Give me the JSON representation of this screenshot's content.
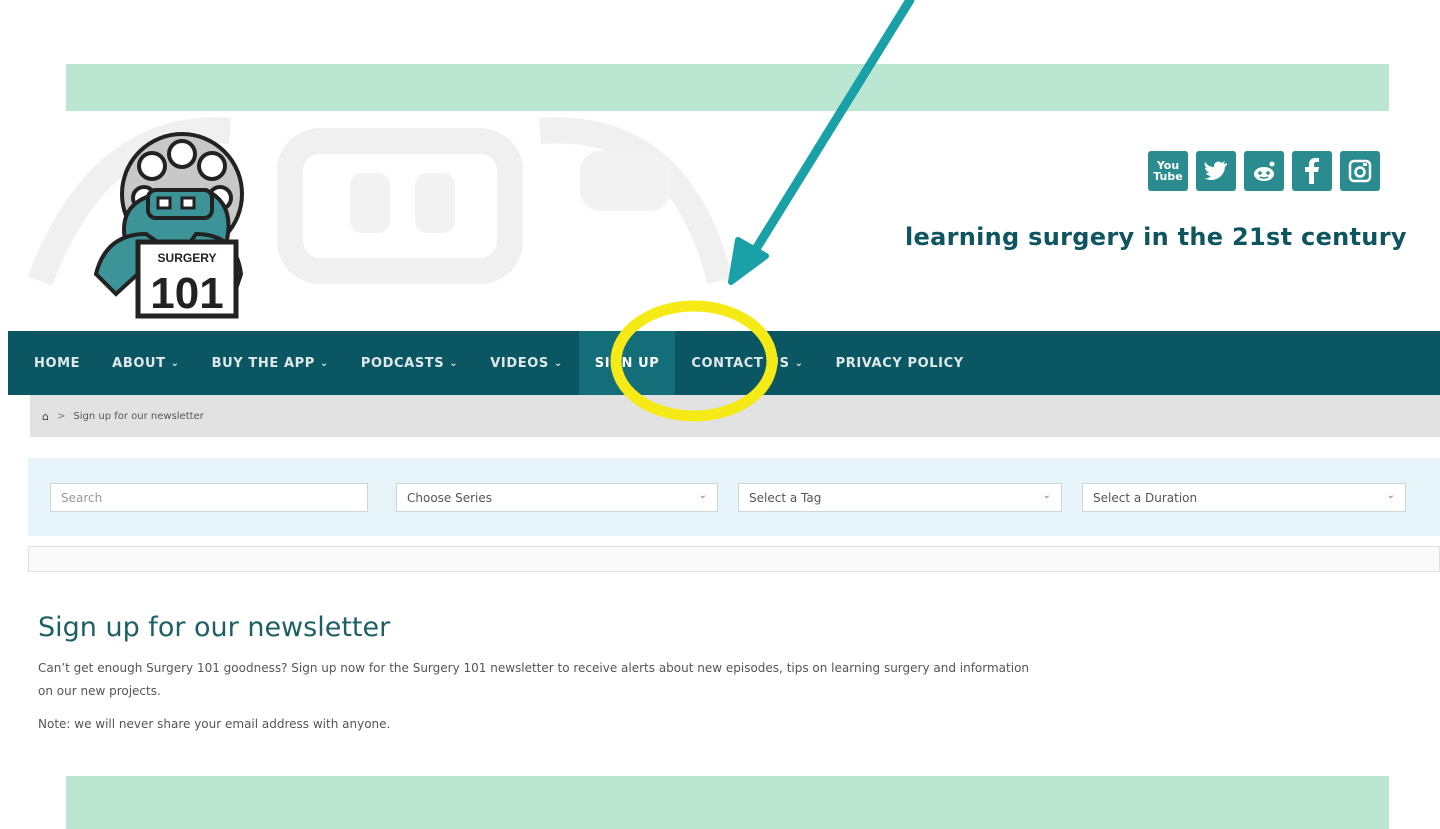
{
  "brand": {
    "logo_text_top": "SURGERY",
    "logo_text_bottom": "101",
    "tagline": "learning surgery in the 21st century",
    "social_icons": [
      "youtube-icon",
      "twitter-icon",
      "reddit-icon",
      "facebook-icon",
      "instagram-icon"
    ],
    "youtube_label": "You Tube",
    "accent_color": "#0b5663",
    "icon_color": "#2a8c8e"
  },
  "nav": {
    "items": [
      {
        "label": "HOME",
        "caret": ""
      },
      {
        "label": "ABOUT",
        "caret": "⌄"
      },
      {
        "label": "BUY THE APP",
        "caret": "⌄"
      },
      {
        "label": "PODCASTS",
        "caret": "⌄"
      },
      {
        "label": "VIDEOS",
        "caret": "⌄"
      },
      {
        "label": "SIGN UP",
        "caret": ""
      },
      {
        "label": "CONTACT US",
        "caret": "⌄"
      },
      {
        "label": "PRIVACY POLICY",
        "caret": ""
      }
    ],
    "active": "SIGN UP"
  },
  "breadcrumb": {
    "current": "Sign up for our newsletter",
    "separator": ">"
  },
  "filters": {
    "search_placeholder": "Search",
    "series": "Choose Series",
    "tag": "Select a Tag",
    "duration": "Select a Duration",
    "arrow": "⌄"
  },
  "content": {
    "title": "Sign up for our newsletter",
    "paragraph": "Can’t get enough Surgery 101 goodness? Sign up now for the Surgery 101 newsletter to receive alerts about new episodes, tips on learning surgery and information on our new projects.",
    "note": "Note: we will never share your email address with anyone."
  },
  "annotation": {
    "arrow_color": "#1aa1a8",
    "circle_color": "#f5ea16",
    "band_color": "#bbe7d2"
  }
}
